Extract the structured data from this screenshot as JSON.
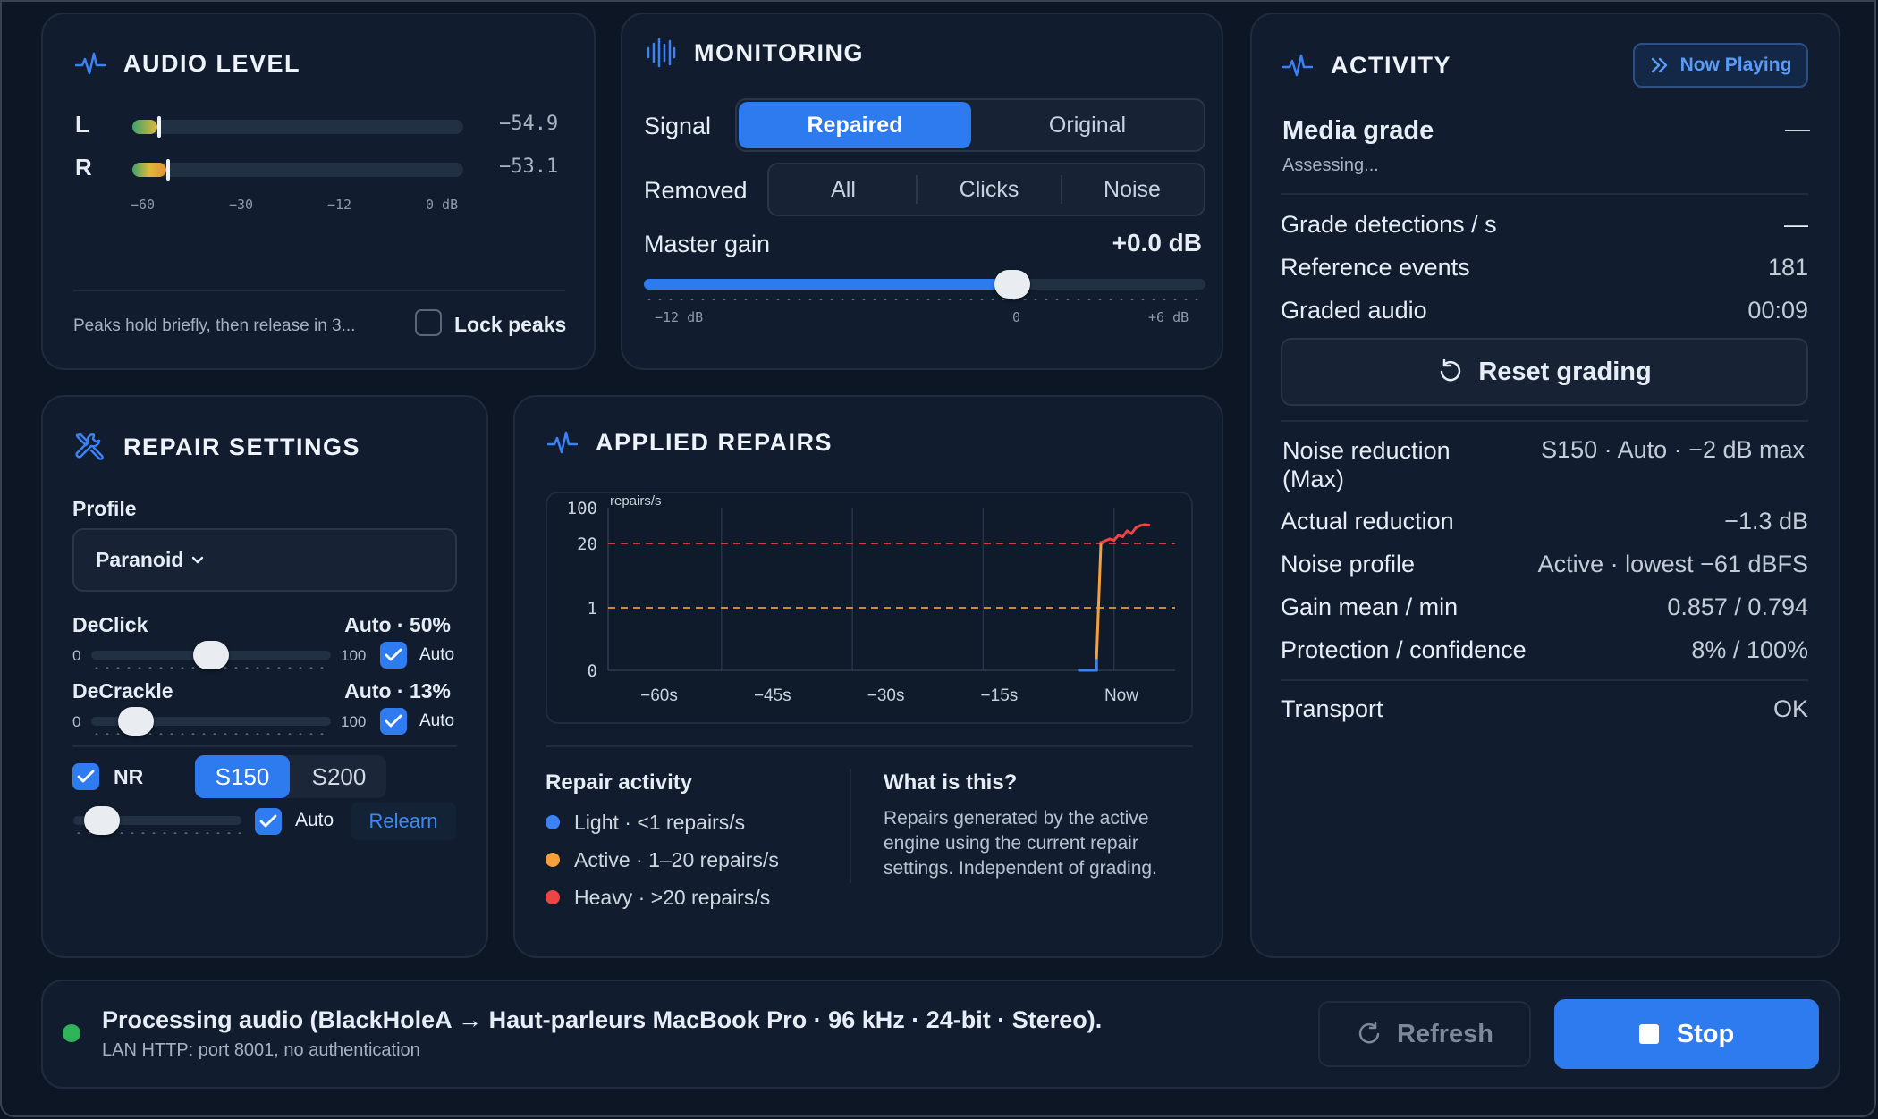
{
  "audio_level": {
    "title": "AUDIO LEVEL",
    "left_label": "L",
    "right_label": "R",
    "left_value": "−54.9",
    "right_value": "−53.1",
    "left_fill": 0.09,
    "right_fill": 0.12,
    "scale": [
      "−60",
      "−30",
      "−12",
      "0 dB"
    ],
    "peaks_note": "Peaks hold briefly, then release in 3...",
    "lock_peaks_label": "Lock peaks"
  },
  "monitoring": {
    "title": "MONITORING",
    "signal_label": "Signal",
    "signal_options": [
      "Repaired",
      "Original"
    ],
    "removed_label": "Removed",
    "removed_options": [
      "All",
      "Clicks",
      "Noise"
    ],
    "master_gain_label": "Master gain",
    "master_gain_value": "+0.0 dB",
    "gain_scale": [
      "−12 dB",
      "0",
      "+6 dB"
    ]
  },
  "activity": {
    "title": "ACTIVITY",
    "now_playing_label": "Now Playing",
    "media_grade_label": "Media grade",
    "media_grade_value": "—",
    "assessing": "Assessing...",
    "rows1": [
      {
        "label": "Grade detections / s",
        "value": "—"
      },
      {
        "label": "Reference events",
        "value": "181"
      },
      {
        "label": "Graded audio",
        "value": "00:09"
      }
    ],
    "reset_label": "Reset grading",
    "nr_label_line1": "Noise reduction",
    "nr_label_line2": "(Max)",
    "nr_value": "S150 · Auto · −2 dB max",
    "rows2": [
      {
        "label": "Actual reduction",
        "value": "−1.3 dB"
      },
      {
        "label": "Noise profile",
        "value": "Active · lowest −61 dBFS"
      },
      {
        "label": "Gain mean / min",
        "value": "0.857 / 0.794"
      },
      {
        "label": "Protection / confidence",
        "value": "8% / 100%"
      }
    ],
    "transport_label": "Transport",
    "transport_value": "OK"
  },
  "repair_settings": {
    "title": "REPAIR SETTINGS",
    "profile_label": "Profile",
    "profile_value": "Paranoid",
    "declick_label": "DeClick",
    "declick_value": "Auto · 50%",
    "decrackle_label": "DeCrackle",
    "decrackle_value": "Auto · 13%",
    "min": "0",
    "max": "100",
    "auto_label": "Auto",
    "nr_label": "NR",
    "nr_options": [
      "S150",
      "S200"
    ],
    "relearn_label": "Relearn"
  },
  "applied_repairs": {
    "title": "APPLIED REPAIRS",
    "legend_title": "Repair activity",
    "legend": [
      {
        "label": "Light · <1 repairs/s",
        "color": "#3b82f6"
      },
      {
        "label": "Active · 1–20 repairs/s",
        "color": "#f5a03a"
      },
      {
        "label": "Heavy · >20 repairs/s",
        "color": "#ef4444"
      }
    ],
    "info_title": "What is this?",
    "info_text": "Repairs generated by the active engine using the current repair settings. Independent of grading."
  },
  "chart_data": {
    "type": "line",
    "ylabel": "repairs/s",
    "x_ticks": [
      "−60s",
      "−45s",
      "−30s",
      "−15s",
      "Now"
    ],
    "y_ticks": [
      "100",
      "20",
      "1",
      "0"
    ],
    "thresholds": [
      20,
      1
    ],
    "series": [
      {
        "x": [
          -8,
          -6,
          -6,
          -5.5,
          -5,
          -4.5,
          -4,
          -3.5,
          -3,
          -2.5,
          -2,
          -1.5,
          -1,
          -0.5,
          0
        ],
        "y": [
          0,
          0,
          0.2,
          22,
          26,
          30,
          27,
          38,
          35,
          48,
          42,
          55,
          60,
          62,
          61
        ]
      }
    ]
  },
  "status": {
    "message": "Processing audio (BlackHoleA → Haut-parleurs MacBook Pro · 96 kHz · 24-bit · Stereo).",
    "sub": "LAN HTTP: port 8001, no authentication",
    "refresh_label": "Refresh",
    "stop_label": "Stop"
  }
}
